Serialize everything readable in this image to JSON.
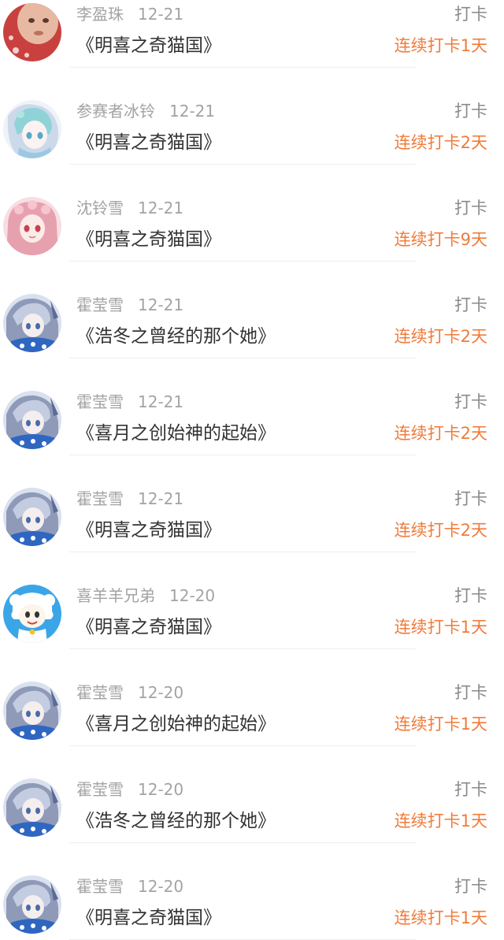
{
  "checkins": [
    {
      "user": "李盈珠",
      "date": "12-21",
      "action": "打卡",
      "title": "《明喜之奇猫国》",
      "streak": "连续打卡1天",
      "avatar": "baby-photo-avatar"
    },
    {
      "user": "参赛者冰铃",
      "date": "12-21",
      "action": "打卡",
      "title": "《明喜之奇猫国》",
      "streak": "连续打卡2天",
      "avatar": "anime-girl-teal-avatar"
    },
    {
      "user": "沈铃雪",
      "date": "12-21",
      "action": "打卡",
      "title": "《明喜之奇猫国》",
      "streak": "连续打卡9天",
      "avatar": "anime-girl-pink-avatar"
    },
    {
      "user": "霍莹雪",
      "date": "12-21",
      "action": "打卡",
      "title": "《浩冬之曾经的那个她》",
      "streak": "连续打卡2天",
      "avatar": "anime-girl-blue-avatar"
    },
    {
      "user": "霍莹雪",
      "date": "12-21",
      "action": "打卡",
      "title": "《喜月之创始神的起始》",
      "streak": "连续打卡2天",
      "avatar": "anime-girl-blue-avatar"
    },
    {
      "user": "霍莹雪",
      "date": "12-21",
      "action": "打卡",
      "title": "《明喜之奇猫国》",
      "streak": "连续打卡2天",
      "avatar": "anime-girl-blue-avatar"
    },
    {
      "user": "喜羊羊兄弟",
      "date": "12-20",
      "action": "打卡",
      "title": "《明喜之奇猫国》",
      "streak": "连续打卡1天",
      "avatar": "pleasant-goat-avatar"
    },
    {
      "user": "霍莹雪",
      "date": "12-20",
      "action": "打卡",
      "title": "《喜月之创始神的起始》",
      "streak": "连续打卡1天",
      "avatar": "anime-girl-blue-avatar"
    },
    {
      "user": "霍莹雪",
      "date": "12-20",
      "action": "打卡",
      "title": "《浩冬之曾经的那个她》",
      "streak": "连续打卡1天",
      "avatar": "anime-girl-blue-avatar"
    },
    {
      "user": "霍莹雪",
      "date": "12-20",
      "action": "打卡",
      "title": "《明喜之奇猫国》",
      "streak": "连续打卡1天",
      "avatar": "anime-girl-blue-avatar"
    }
  ],
  "colors": {
    "streak": "#f07b3a",
    "meta": "#a3a3a3",
    "title": "#333333",
    "divider": "#efefef"
  }
}
